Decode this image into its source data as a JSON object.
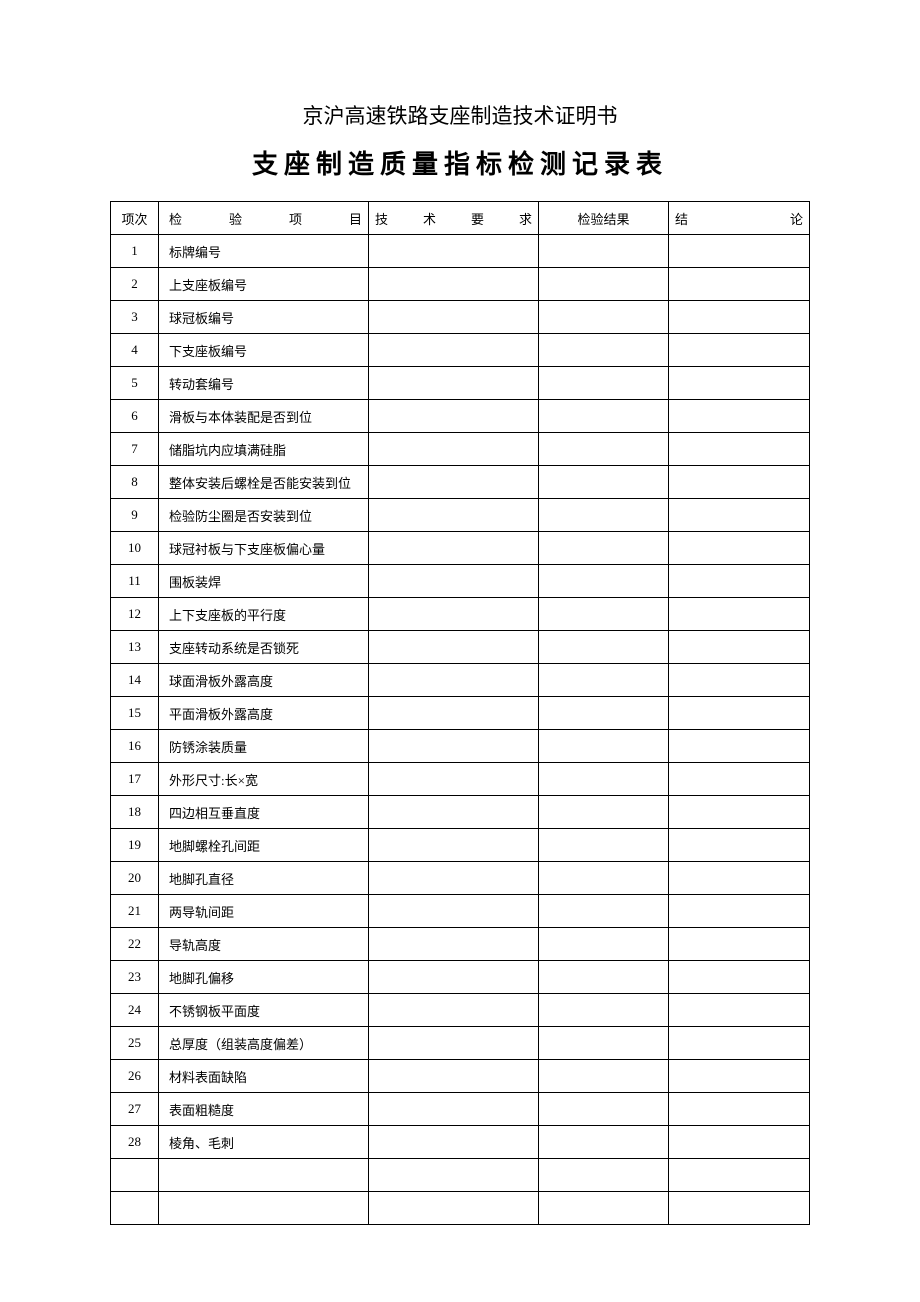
{
  "title1": "京沪高速铁路支座制造技术证明书",
  "title2": "支座制造质量指标检测记录表",
  "headers": {
    "idx": "项次",
    "item": "检　验　项　目",
    "req": "技　术　要　求",
    "result": "检验结果",
    "conclusion": "结　　论"
  },
  "rows": [
    {
      "idx": "1",
      "item": "标牌编号",
      "req": "",
      "result": "",
      "conclusion": ""
    },
    {
      "idx": "2",
      "item": "上支座板编号",
      "req": "",
      "result": "",
      "conclusion": ""
    },
    {
      "idx": "3",
      "item": "球冠板编号",
      "req": "",
      "result": "",
      "conclusion": ""
    },
    {
      "idx": "4",
      "item": "下支座板编号",
      "req": "",
      "result": "",
      "conclusion": ""
    },
    {
      "idx": "5",
      "item": "转动套编号",
      "req": "",
      "result": "",
      "conclusion": ""
    },
    {
      "idx": "6",
      "item": "滑板与本体装配是否到位",
      "req": "",
      "result": "",
      "conclusion": ""
    },
    {
      "idx": "7",
      "item": "储脂坑内应填满硅脂",
      "req": "",
      "result": "",
      "conclusion": ""
    },
    {
      "idx": "8",
      "item": "整体安装后螺栓是否能安装到位",
      "req": "",
      "result": "",
      "conclusion": ""
    },
    {
      "idx": "9",
      "item": "检验防尘圈是否安装到位",
      "req": "",
      "result": "",
      "conclusion": ""
    },
    {
      "idx": "10",
      "item": "球冠衬板与下支座板偏心量",
      "req": "",
      "result": "",
      "conclusion": ""
    },
    {
      "idx": "11",
      "item": "围板装焊",
      "req": "",
      "result": "",
      "conclusion": ""
    },
    {
      "idx": "12",
      "item": "上下支座板的平行度",
      "req": "",
      "result": "",
      "conclusion": ""
    },
    {
      "idx": "13",
      "item": "支座转动系统是否锁死",
      "req": "",
      "result": "",
      "conclusion": ""
    },
    {
      "idx": "14",
      "item": "球面滑板外露高度",
      "req": "",
      "result": "",
      "conclusion": ""
    },
    {
      "idx": "15",
      "item": "平面滑板外露高度",
      "req": "",
      "result": "",
      "conclusion": ""
    },
    {
      "idx": "16",
      "item": "防锈涂装质量",
      "req": "",
      "result": "",
      "conclusion": ""
    },
    {
      "idx": "17",
      "item": "外形尺寸:长×宽",
      "req": "",
      "result": "",
      "conclusion": ""
    },
    {
      "idx": "18",
      "item": "四边相互垂直度",
      "req": "",
      "result": "",
      "conclusion": ""
    },
    {
      "idx": "19",
      "item": "地脚螺栓孔间距",
      "req": "",
      "result": "",
      "conclusion": ""
    },
    {
      "idx": "20",
      "item": "地脚孔直径",
      "req": "",
      "result": "",
      "conclusion": ""
    },
    {
      "idx": "21",
      "item": "两导轨间距",
      "req": "",
      "result": "",
      "conclusion": ""
    },
    {
      "idx": "22",
      "item": "导轨高度",
      "req": "",
      "result": "",
      "conclusion": ""
    },
    {
      "idx": "23",
      "item": "地脚孔偏移",
      "req": "",
      "result": "",
      "conclusion": ""
    },
    {
      "idx": "24",
      "item": "不锈钢板平面度",
      "req": "",
      "result": "",
      "conclusion": ""
    },
    {
      "idx": "25",
      "item": "总厚度（组装高度偏差）",
      "req": "",
      "result": "",
      "conclusion": ""
    },
    {
      "idx": "26",
      "item": "材料表面缺陷",
      "req": "",
      "result": "",
      "conclusion": ""
    },
    {
      "idx": "27",
      "item": "表面粗糙度",
      "req": "",
      "result": "",
      "conclusion": ""
    },
    {
      "idx": "28",
      "item": "棱角、毛刺",
      "req": "",
      "result": "",
      "conclusion": ""
    },
    {
      "idx": "",
      "item": "",
      "req": "",
      "result": "",
      "conclusion": ""
    },
    {
      "idx": "",
      "item": "",
      "req": "",
      "result": "",
      "conclusion": ""
    }
  ]
}
